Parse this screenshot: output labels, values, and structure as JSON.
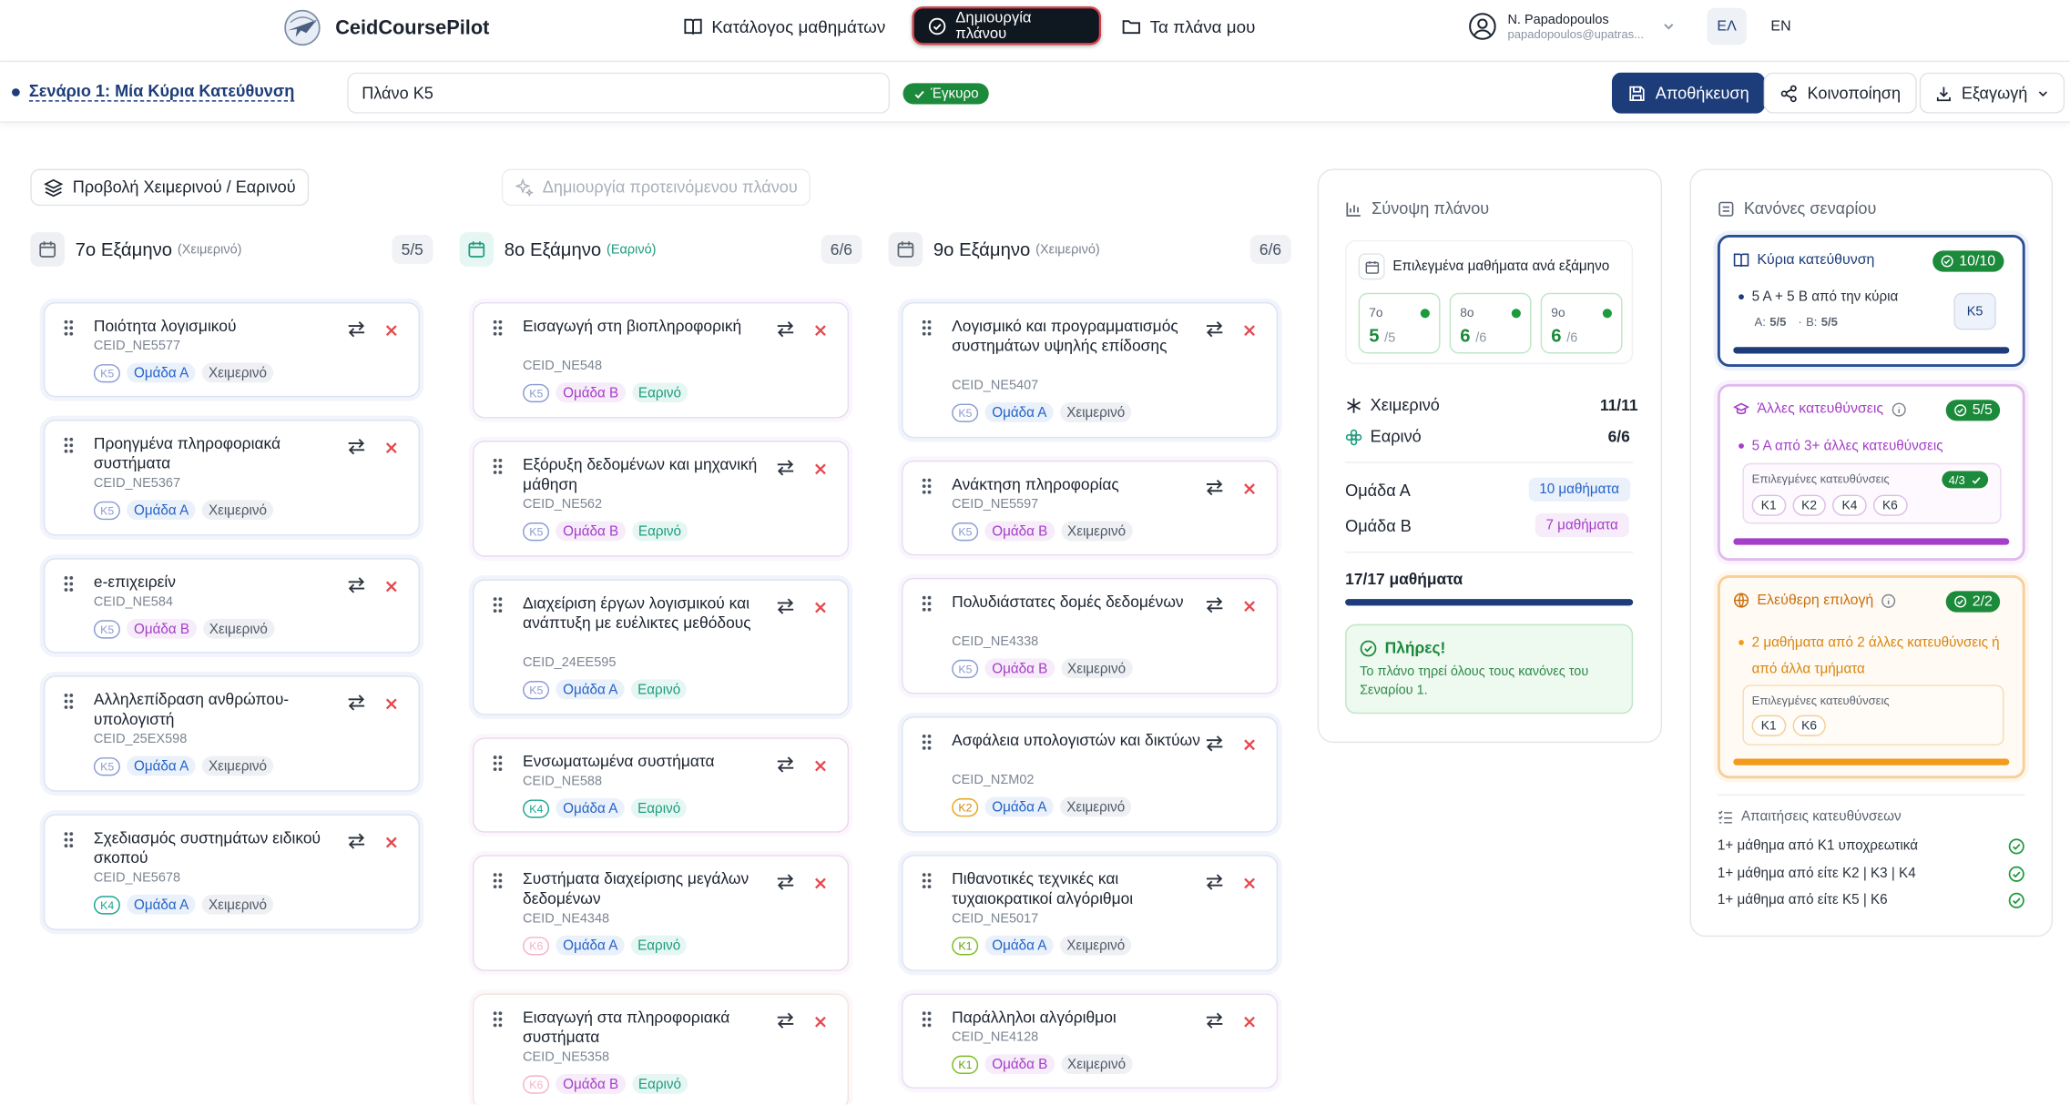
{
  "app": {
    "brand": "CeidCoursePilot"
  },
  "nav": {
    "catalog": "Κατάλογος μαθημάτων",
    "create": "Δημιουργία πλάνου",
    "myplans": "Τα πλάνα μου"
  },
  "user": {
    "name": "N. Papadopoulos",
    "email": "papadopoulos@upatras..."
  },
  "lang": {
    "el": "ΕΛ",
    "en": "EN"
  },
  "subbar": {
    "scenario": "Σενάριο 1: Μία Κύρια Κατεύθυνση",
    "plan_name": "Πλάνο K5",
    "valid": "Έγκυρο",
    "save": "Αποθήκευση",
    "share": "Κοινοποίηση",
    "export": "Εξαγωγή"
  },
  "tools": {
    "view_toggle": "Προβολή Χειμερινού / Εαρινού",
    "suggest": "Δημιουργία προτεινόμενου πλάνου"
  },
  "columns": [
    {
      "title": "7ο Εξάμηνο",
      "season": "(Χειμερινό)",
      "count": "5/5",
      "courses": [
        {
          "title": "Ποιότητα λογισμικού",
          "code": "CEID_NE5577",
          "k": "K5",
          "group": "Ομάδα Α",
          "season": "Χειμερινό"
        },
        {
          "title": "Προηγμένα πληροφοριακά συστήματα",
          "code": "CEID_NE5367",
          "k": "K5",
          "group": "Ομάδα Α",
          "season": "Χειμερινό"
        },
        {
          "title": "e-επιχειρείν",
          "code": "CEID_NE584",
          "k": "K5",
          "group": "Ομάδα Β",
          "season": "Χειμερινό"
        },
        {
          "title": "Αλληλεπίδραση ανθρώπου-υπολογιστή",
          "code": "CEID_25EX598",
          "k": "K5",
          "group": "Ομάδα Α",
          "season": "Χειμερινό"
        },
        {
          "title": "Σχεδιασμός συστημάτων ειδικού σκοπού",
          "code": "CEID_NE5678",
          "k": "K4",
          "group": "Ομάδα Α",
          "season": "Χειμερινό"
        }
      ]
    },
    {
      "title": "8ο Εξάμηνο",
      "season": "(Εαρινό)",
      "count": "6/6",
      "courses": [
        {
          "title": "Εισαγωγή στη βιοπληροφορική",
          "code": "CEID_NE548",
          "k": "K5",
          "group": "Ομάδα Β",
          "season": "Εαρινό"
        },
        {
          "title": "Εξόρυξη δεδομένων και μηχανική μάθηση",
          "code": "CEID_NE562",
          "k": "K5",
          "group": "Ομάδα Β",
          "season": "Εαρινό"
        },
        {
          "title": "Διαχείριση έργων λογισμικού και ανάπτυξη με ευέλικτες μεθόδους",
          "code": "CEID_24EE595",
          "k": "K5",
          "group": "Ομάδα Α",
          "season": "Εαρινό"
        },
        {
          "title": "Ενσωματωμένα συστήματα",
          "code": "CEID_NE588",
          "k": "K4",
          "group": "Ομάδα Α",
          "season": "Εαρινό"
        },
        {
          "title": "Συστήματα διαχείρισης μεγάλων δεδομένων",
          "code": "CEID_NE4348",
          "k": "K6",
          "group": "Ομάδα Α",
          "season": "Εαρινό"
        },
        {
          "title": "Εισαγωγή στα πληροφοριακά συστήματα",
          "code": "CEID_NE5358",
          "k": "K6",
          "group": "Ομάδα Β",
          "season": "Εαρινό"
        }
      ]
    },
    {
      "title": "9ο Εξάμηνο",
      "season": "(Χειμερινό)",
      "count": "6/6",
      "courses": [
        {
          "title": "Λογισμικό και προγραμματισμός συστημάτων υψηλής επίδοσης",
          "code": "CEID_NE5407",
          "k": "K5",
          "group": "Ομάδα Α",
          "season": "Χειμερινό"
        },
        {
          "title": "Ανάκτηση πληροφορίας",
          "code": "CEID_NE5597",
          "k": "K5",
          "group": "Ομάδα Β",
          "season": "Χειμερινό"
        },
        {
          "title": "Πολυδιάστατες δομές δεδομένων",
          "code": "CEID_NE4338",
          "k": "K5",
          "group": "Ομάδα Β",
          "season": "Χειμερινό"
        },
        {
          "title": "Ασφάλεια υπολογιστών και δικτύων",
          "code": "CEID_ΝΣΜ02",
          "k": "K2",
          "group": "Ομάδα Α",
          "season": "Χειμερινό"
        },
        {
          "title": "Πιθανοτικές τεχνικές και τυχαιοκρατικοί αλγόριθμοι",
          "code": "CEID_NE5017",
          "k": "K1",
          "group": "Ομάδα Α",
          "season": "Χειμερινό"
        },
        {
          "title": "Παράλληλοι αλγόριθμοι",
          "code": "CEID_NE4128",
          "k": "K1",
          "group": "Ομάδα Β",
          "season": "Χειμερινό"
        }
      ]
    }
  ],
  "summary": {
    "title": "Σύνοψη πλάνου",
    "per_sem": "Επιλεγμένα μαθήματα ανά εξάμηνο",
    "sems": [
      {
        "label": "7ο",
        "value": "5",
        "max": "/5"
      },
      {
        "label": "8ο",
        "value": "6",
        "max": "/6"
      },
      {
        "label": "9ο",
        "value": "6",
        "max": "/6"
      }
    ],
    "winter": "Χειμερινό",
    "winter_val": "11/11",
    "spring": "Εαρινό",
    "spring_val": "6/6",
    "groupA": "Ομάδα Α",
    "groupA_val": "10 μαθήματα",
    "groupB": "Ομάδα Β",
    "groupB_val": "7 μαθήματα",
    "total": "17/17 μαθήματα",
    "progress": 1.0,
    "ok_title": "Πλήρες!",
    "ok_text": "Το πλάνο τηρεί όλους τους κανόνες του Σεναρίου 1."
  },
  "rules": {
    "title": "Κανόνες σεναρίου",
    "main": {
      "title": "Κύρια κατεύθυνση",
      "badge": "10/10",
      "desc": "5 Α + 5 Β από την κύρια",
      "a_label": "A:",
      "a_val": "5/5",
      "b_label": "B:",
      "b_val": "5/5",
      "chip": "K5"
    },
    "other": {
      "title": "Άλλες κατευθύνσεις",
      "badge": "5/5",
      "desc": "5 Α από 3+ άλλες κατευθύνσεις",
      "sel_label": "Επιλεγμένες κατευθύνσεις",
      "sel_badge": "4/3",
      "chips": [
        "K1",
        "K2",
        "K4",
        "K6"
      ]
    },
    "free": {
      "title": "Ελεύθερη επιλογή",
      "badge": "2/2",
      "desc": "2 μαθήματα από 2 άλλες κατευθύνσεις ή από άλλα τμήματα",
      "sel_label": "Επιλεγμένες κατευθύνσεις",
      "chips": [
        "K1",
        "K6"
      ]
    },
    "req_title": "Απαιτήσεις κατευθύνσεων",
    "reqs": [
      "1+ μάθημα από K1 υποχρεωτικά",
      "1+ μάθημα από είτε K2 | K3 | K4",
      "1+ μάθημα από είτε K5 | K6"
    ]
  },
  "colors": {
    "primary": "#1d3d7a",
    "green": "#1b8a3a",
    "purple": "#a53ec8",
    "orange": "#f29b1c"
  }
}
